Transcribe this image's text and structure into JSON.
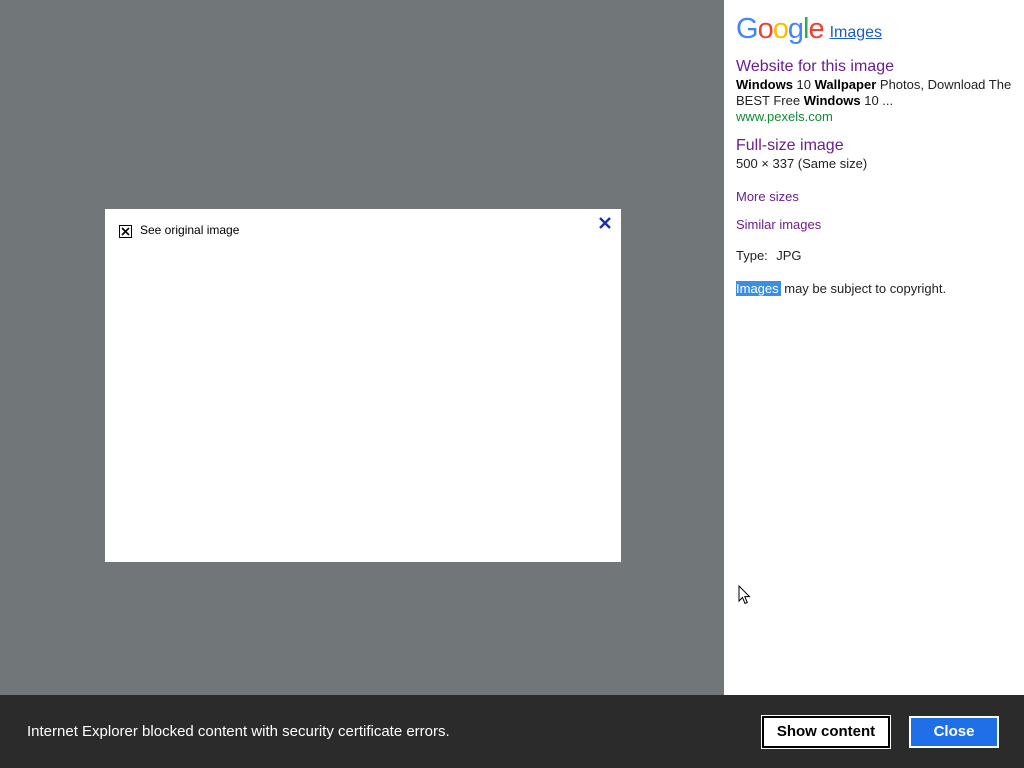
{
  "image_viewer": {
    "see_original_label": "See original image"
  },
  "panel": {
    "brand": {
      "logo_letters": [
        "G",
        "o",
        "o",
        "g",
        "l",
        "e"
      ],
      "images_link": "Images"
    },
    "website": {
      "link_label": "Website for this image",
      "snippet_parts": [
        {
          "text": "Windows",
          "bold": true
        },
        {
          "text": " 10 ",
          "bold": false
        },
        {
          "text": "Wallpaper",
          "bold": true
        },
        {
          "text": " Photos, Download The BEST Free ",
          "bold": false
        },
        {
          "text": "Windows",
          "bold": true
        },
        {
          "text": " 10 ...",
          "bold": false
        }
      ],
      "url": "www.pexels.com"
    },
    "full_size": {
      "link_label": "Full-size image",
      "dimensions": "500 × 337 (Same size)"
    },
    "more_sizes": "More sizes",
    "similar_images": "Similar images",
    "type_label": "Type:",
    "type_value": "JPG",
    "copyright": {
      "highlighted": "Images",
      "rest": " may be subject to copyright."
    }
  },
  "notification": {
    "message": "Internet Explorer blocked content with security certificate errors.",
    "show_content_label": "Show content",
    "close_label": "Close"
  },
  "colors": {
    "viewer_bg": "#717678",
    "notification_bg": "#2b2b2b",
    "close_button_bg": "#1f6fe8",
    "link_purple": "#6a1f8e",
    "url_green": "#108a35",
    "selection_blue": "#3b8fde"
  }
}
